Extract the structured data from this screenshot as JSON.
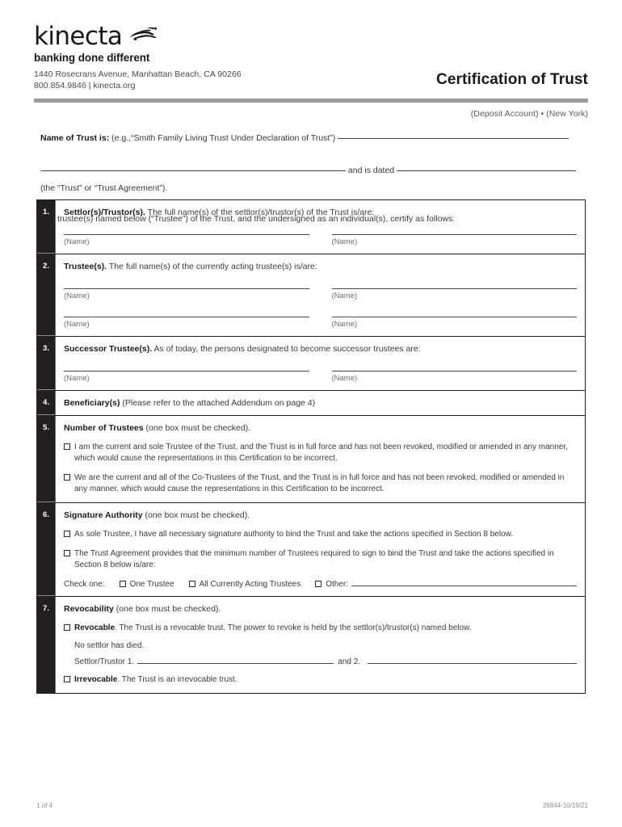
{
  "header": {
    "wordmark": "kinecta",
    "logo_mark_name": "kinecta-swoosh-logo",
    "tagline": "banking done different",
    "address_line1": "1440 Rosecrans Avenue, Manhattan Beach, CA 90266",
    "address_line2": "800.854.9846 | kinecta.org",
    "doc_title": "Certification of Trust",
    "subtitle": "(Deposit Account) • (New York)",
    "rule_color": "#9a9b9d"
  },
  "intro": {
    "name_label": "Name of Trust is:",
    "name_example": "(e.g.,“Smith Family Living Trust Under Declaration of Trust”)",
    "dated_label": "and is dated",
    "trust_parenthetical": "(the “Trust” or “Trust Agreement”).",
    "certify_line": "The trustee(s) named below (“Trustee”) of the Trust, and the undersigned as an individual(s), certify as follows:"
  },
  "sections": [
    {
      "num": "1.",
      "title_bold": "Settlor(s)/Trustor(s).",
      "title_rest": "The full name(s) of the settlor(s)/trustor(s) of the Trust is/are:",
      "name_rows": [
        [
          "(Name)",
          "(Name)"
        ]
      ]
    },
    {
      "num": "2.",
      "title_bold": "Trustee(s).",
      "title_rest": "The full name(s) of the currently acting trustee(s) is/are:",
      "name_rows": [
        [
          "(Name)",
          "(Name)"
        ],
        [
          "(Name)",
          "(Name)"
        ]
      ]
    },
    {
      "num": "3.",
      "title_bold": "Successor Trustee(s).",
      "title_rest": "As of today, the persons designated to become successor trustees are:",
      "name_rows": [
        [
          "(Name)",
          "(Name)"
        ]
      ]
    },
    {
      "num": "4.",
      "title_bold": "Beneficiary(s)",
      "title_rest": "(Please refer to the attached Addendum on page 4)"
    },
    {
      "num": "5.",
      "title_bold": "Number of Trustees",
      "title_rest": "(one box must be checked).",
      "checkboxes": [
        "I am the current and sole Trustee of the Trust, and the Trust is in full force and has not been revoked, modified or amended in any manner, which would cause the representations in this Certification to be incorrect.",
        "We are the current and all of the Co-Trustees of the Trust, and the Trust is in full force and has not been revoked, modified or amended in any manner, which would cause the representations in this Certification to be incorrect."
      ]
    },
    {
      "num": "6.",
      "title_bold": "Signature Authority",
      "title_rest": "(one box must be checked).",
      "checkboxes": [
        "As sole Trustee, I have all necessary signature authority to bind the Trust and take the actions specified in Section 8 below.",
        "The Trust Agreement provides that the minimum number of Trustees required to sign to bind the Trust and take the actions specified in Section 8 below is/are:"
      ],
      "check_one_label": "Check one:",
      "check_one_options": [
        "One Trustee",
        "All Currently Acting Trustees",
        "Other:"
      ]
    },
    {
      "num": "7.",
      "title_bold": "Revocability",
      "title_rest": "(one box must be checked).",
      "revocable_bold": "Revocable",
      "revocable_rest": ". The Trust is a revocable trust. The power to revoke is held by the settlor(s)/trustor(s) named below.",
      "no_settlor_line": "No settlor has died.",
      "settlor_label": "Settlor/Trustor 1.",
      "settlor_and": "and 2.",
      "irrevocable_bold": "Irrevocable",
      "irrevocable_rest": ". The Trust is an irrevocable trust."
    }
  ],
  "footer": {
    "page_label": "1 of 4",
    "form_code": "26844-10/19/21"
  }
}
